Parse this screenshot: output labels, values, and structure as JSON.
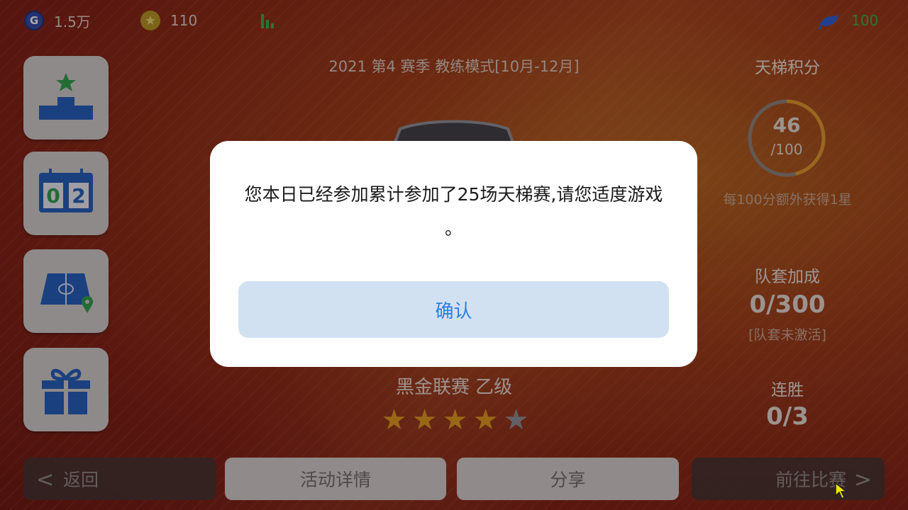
{
  "topbar": {
    "gold": {
      "icon": "g-coin-icon",
      "letter": "G",
      "value": "1.5万"
    },
    "stars": {
      "icon": "star-coin-icon",
      "glyph": "★",
      "value": "110"
    },
    "signal": {
      "icon": "signal-icon"
    },
    "energy": {
      "icon": "energy-icon",
      "value": "100"
    }
  },
  "sidebar": [
    {
      "name": "podium",
      "icon": "podium-star-icon"
    },
    {
      "name": "scoreboard",
      "icon": "scoreboard-icon",
      "digits": [
        "0",
        "2"
      ]
    },
    {
      "name": "pitch",
      "icon": "pitch-location-icon"
    },
    {
      "name": "gift",
      "icon": "gift-icon"
    }
  ],
  "main": {
    "season": "2021 第4 赛季 教练模式[10月-12月]",
    "league": "黑金联赛 乙级",
    "stars_filled": 4,
    "stars_total": 5,
    "star_glyph": "★"
  },
  "right_panel": {
    "ladder_label": "天梯积分",
    "ladder_points": "46",
    "ladder_max": "/100",
    "ladder_progress": 0.46,
    "ladder_note": "每100分额外获得1星",
    "team_label": "队套加成",
    "team_value": "0/300",
    "team_note": "[队套未激活]",
    "streak_label": "连胜",
    "streak_value": "0/3"
  },
  "bottom": {
    "back": "返回",
    "details": "活动详情",
    "share": "分享",
    "go_match": "前往比赛",
    "chev_left": "<",
    "chev_right": ">"
  },
  "dialog": {
    "message": "您本日已经参加累计参加了25场天梯赛,请您适度游戏 。",
    "confirm": "确认"
  },
  "colors": {
    "accent_blue": "#2a7fe0",
    "star_gold": "#e09c1e",
    "ring_gold": "#e09a2a",
    "energy_green": "#2fb24a",
    "icon_blue": "#1f5fbf"
  }
}
